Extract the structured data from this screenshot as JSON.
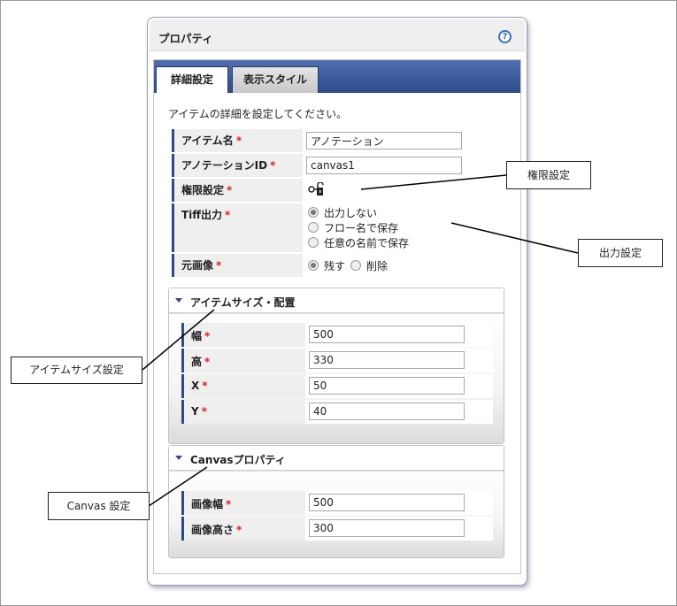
{
  "panel": {
    "title": "プロパティ",
    "help_icon": "?"
  },
  "tabs": [
    {
      "label": "詳細設定"
    },
    {
      "label": "表示スタイル"
    }
  ],
  "description": "アイテムの詳細を設定してください。",
  "required_mark": "*",
  "fields": {
    "item_name": {
      "label": "アイテム名",
      "value": "アノテーション"
    },
    "annotation_id": {
      "label": "アノテーションID",
      "value": "canvas1"
    },
    "permission": {
      "label": "権限設定",
      "icon": "unlock-icon"
    },
    "tiff_output": {
      "label": "Tiff出力",
      "options": [
        "出力しない",
        "フロー名で保存",
        "任意の名前で保存"
      ],
      "selected": "出力しない"
    },
    "original_image": {
      "label": "元画像",
      "options": [
        "残す",
        "削除"
      ],
      "selected": "残す"
    }
  },
  "size_section": {
    "title": "アイテムサイズ・配置",
    "rows": [
      {
        "label": "幅",
        "value": "500"
      },
      {
        "label": "高",
        "value": "330"
      },
      {
        "label": "X",
        "value": "50"
      },
      {
        "label": "Y",
        "value": "40"
      }
    ]
  },
  "canvas_section": {
    "title": "Canvasプロパティ",
    "rows": [
      {
        "label": "画像幅",
        "value": "500"
      },
      {
        "label": "画像高さ",
        "value": "300"
      }
    ]
  },
  "callouts": {
    "permission": "権限設定",
    "output": "出力設定",
    "item_size": "アイテムサイズ設定",
    "canvas": "Canvas 設定"
  }
}
